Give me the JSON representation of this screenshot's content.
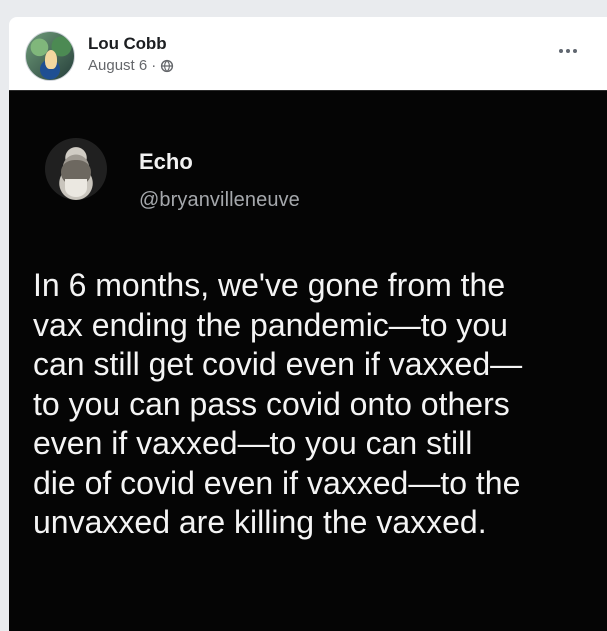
{
  "post": {
    "author": "Lou Cobb",
    "date": "August 6",
    "separator": "·",
    "privacy_icon": "globe-icon",
    "menu_icon": "more-icon"
  },
  "tweet": {
    "display_name": "Echo",
    "handle": "@bryanvilleneuve",
    "text": "In 6 months, we've gone from the\nvax ending the pandemic—to you\ncan still get covid even if vaxxed—\nto you can pass covid onto others\neven if vaxxed—to you can still\ndie of covid even if vaxxed—to the\nunvaxxed are killing the vaxxed."
  },
  "colors": {
    "page_background": "#e9ebee",
    "card_background": "#ffffff",
    "image_background": "#050505",
    "primary_text": "#1c1e21",
    "secondary_text": "#65676b",
    "tweet_text": "#f4f4f4",
    "tweet_handle": "#a5a8ac"
  }
}
